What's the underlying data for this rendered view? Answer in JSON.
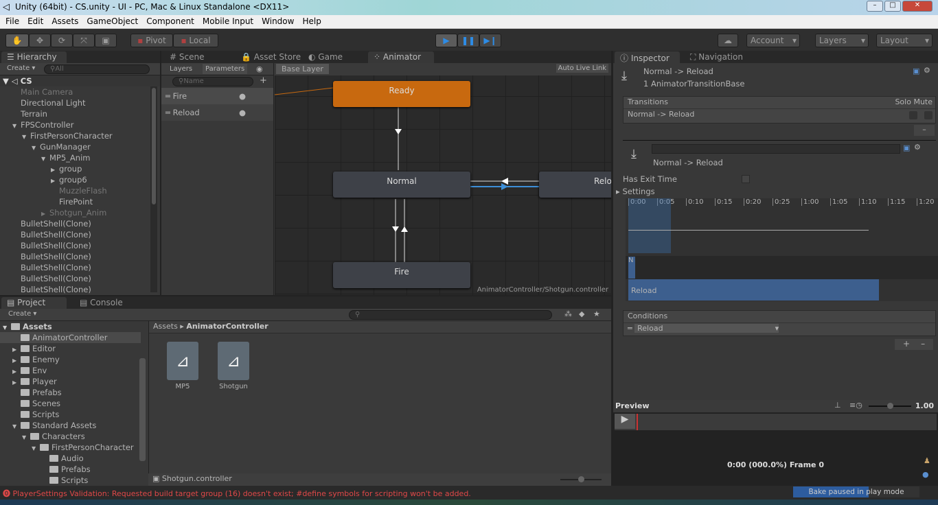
{
  "window": {
    "title": "Unity (64bit) - CS.unity - UI - PC, Mac & Linux Standalone <DX11>",
    "min": "–",
    "max": "□",
    "close": "✕"
  },
  "menu": [
    "File",
    "Edit",
    "Assets",
    "GameObject",
    "Component",
    "Mobile Input",
    "Window",
    "Help"
  ],
  "toolbar": {
    "pivot": "Pivot",
    "local": "Local",
    "account": "Account",
    "layers": "Layers",
    "layout": "Layout",
    "cloud_icon": "cloud-icon",
    "accent": "#2d8ce6"
  },
  "hierarchy": {
    "tab": "Hierarchy",
    "create": "Create",
    "search_placeholder": "All",
    "scene": "CS",
    "items": [
      {
        "label": "Main Camera",
        "indent": 0,
        "dim": true,
        "arrow": ""
      },
      {
        "label": "Directional Light",
        "indent": 0,
        "dim": false,
        "arrow": ""
      },
      {
        "label": "Terrain",
        "indent": 0,
        "dim": false,
        "arrow": ""
      },
      {
        "label": "FPSController",
        "indent": 0,
        "dim": false,
        "arrow": "▼"
      },
      {
        "label": "FirstPersonCharacter",
        "indent": 1,
        "dim": false,
        "arrow": "▼"
      },
      {
        "label": "GunManager",
        "indent": 2,
        "dim": false,
        "arrow": "▼"
      },
      {
        "label": "MP5_Anim",
        "indent": 3,
        "dim": false,
        "arrow": "▼"
      },
      {
        "label": "group",
        "indent": 4,
        "dim": false,
        "arrow": "▶"
      },
      {
        "label": "group6",
        "indent": 4,
        "dim": false,
        "arrow": "▶"
      },
      {
        "label": "MuzzleFlash",
        "indent": 4,
        "dim": true,
        "arrow": ""
      },
      {
        "label": "FirePoint",
        "indent": 4,
        "dim": false,
        "arrow": ""
      },
      {
        "label": "Shotgun_Anim",
        "indent": 3,
        "dim": true,
        "arrow": "▶"
      },
      {
        "label": "BulletShell(Clone)",
        "indent": 0,
        "dim": false,
        "arrow": ""
      },
      {
        "label": "BulletShell(Clone)",
        "indent": 0,
        "dim": false,
        "arrow": ""
      },
      {
        "label": "BulletShell(Clone)",
        "indent": 0,
        "dim": false,
        "arrow": ""
      },
      {
        "label": "BulletShell(Clone)",
        "indent": 0,
        "dim": false,
        "arrow": ""
      },
      {
        "label": "BulletShell(Clone)",
        "indent": 0,
        "dim": false,
        "arrow": ""
      },
      {
        "label": "BulletShell(Clone)",
        "indent": 0,
        "dim": false,
        "arrow": ""
      },
      {
        "label": "BulletShell(Clone)",
        "indent": 0,
        "dim": false,
        "arrow": ""
      }
    ]
  },
  "center_tabs": [
    "Scene",
    "Asset Store",
    "Game",
    "Animator"
  ],
  "animator": {
    "layers_tab": "Layers",
    "parameters_tab": "Parameters",
    "search_placeholder": "Name",
    "breadcrumb": "Base Layer",
    "auto_live_link": "Auto Live Link",
    "parameters": [
      "Fire",
      "Reload"
    ],
    "states": {
      "ready": "Ready",
      "normal": "Normal",
      "reload": "Relo",
      "fire": "Fire"
    },
    "footer": "AnimatorController/Shotgun.controller",
    "default_state_color": "#c8690f",
    "selected_transition_color": "#3d8fd8"
  },
  "project": {
    "tabs": [
      "Project",
      "Console"
    ],
    "create": "Create",
    "tree": [
      {
        "label": "Assets",
        "indent": 0,
        "arrow": "▼",
        "bold": true
      },
      {
        "label": "AnimatorController",
        "indent": 1,
        "arrow": "",
        "selected": true
      },
      {
        "label": "Editor",
        "indent": 1,
        "arrow": "▶"
      },
      {
        "label": "Enemy",
        "indent": 1,
        "arrow": "▶"
      },
      {
        "label": "Env",
        "indent": 1,
        "arrow": "▶"
      },
      {
        "label": "Player",
        "indent": 1,
        "arrow": "▶"
      },
      {
        "label": "Prefabs",
        "indent": 1,
        "arrow": ""
      },
      {
        "label": "Scenes",
        "indent": 1,
        "arrow": ""
      },
      {
        "label": "Scripts",
        "indent": 1,
        "arrow": ""
      },
      {
        "label": "Standard Assets",
        "indent": 1,
        "arrow": "▼"
      },
      {
        "label": "Characters",
        "indent": 2,
        "arrow": "▼"
      },
      {
        "label": "FirstPersonCharacter",
        "indent": 3,
        "arrow": "▼"
      },
      {
        "label": "Audio",
        "indent": 4,
        "arrow": ""
      },
      {
        "label": "Prefabs",
        "indent": 4,
        "arrow": ""
      },
      {
        "label": "Scripts",
        "indent": 4,
        "arrow": ""
      }
    ],
    "breadcrumb": [
      "Assets",
      "AnimatorController"
    ],
    "assets": [
      "MP5",
      "Shotgun"
    ],
    "footer": "Shotgun.controller"
  },
  "inspector": {
    "tabs": [
      "Inspector",
      "Navigation"
    ],
    "title": "Normal -> Reload",
    "subtitle": "1 AnimatorTransitionBase",
    "transitions_header": "Transitions",
    "solo": "Solo",
    "mute": "Mute",
    "transition_row": "Normal -> Reload",
    "remove": "–",
    "sub_title": "Normal -> Reload",
    "has_exit_time": "Has Exit Time",
    "has_exit_time_checked": false,
    "settings": "Settings",
    "timeline_ticks": [
      "0:00",
      "0:05",
      "0:10",
      "0:15",
      "0:20",
      "0:25",
      "1:00",
      "1:05",
      "1:10",
      "1:15",
      "1:20"
    ],
    "timeline_from": "N",
    "timeline_to": "Reload",
    "conditions_header": "Conditions",
    "condition": "Reload",
    "add": "+",
    "remove2": "–"
  },
  "preview": {
    "title": "Preview",
    "speed": "1.00",
    "speed_fraction": 0.5,
    "time": "0:00 (000.0%) Frame 0",
    "bake": "Bake paused in play mode",
    "bake_progress": 0.6
  },
  "status": {
    "message": "PlayerSettings Validation: Requested build target group (16) doesn't exist; #define symbols for scripting won't be added.",
    "color": "#e04848"
  }
}
